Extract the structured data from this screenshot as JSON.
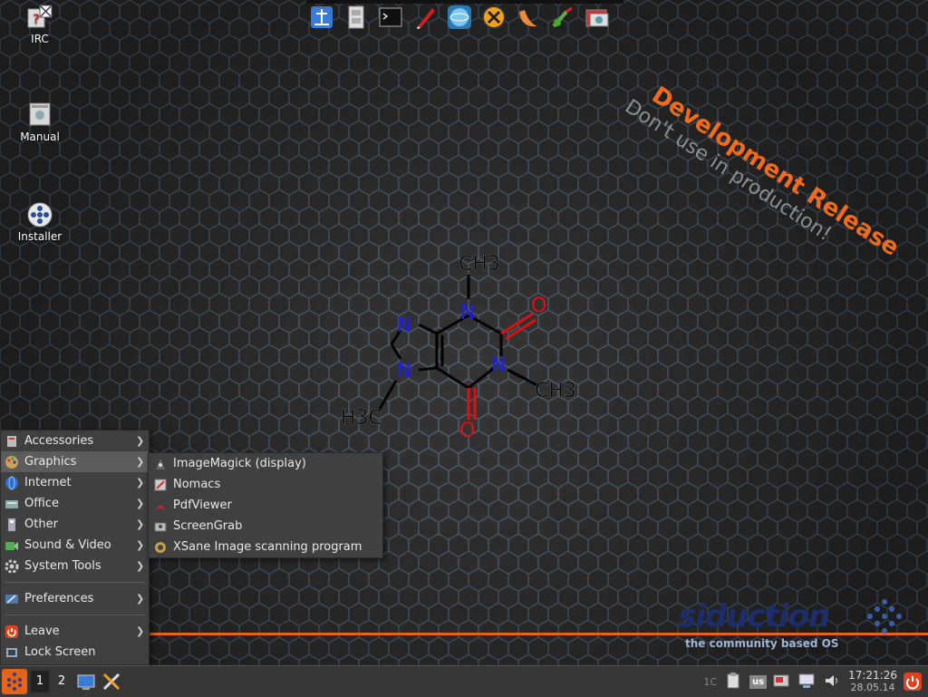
{
  "desktop": {
    "icons": [
      {
        "label": "IRC",
        "icon": "irc-help-icon"
      },
      {
        "label": "Manual",
        "icon": "manual-book-icon"
      },
      {
        "label": "Installer",
        "icon": "installer-disc-icon"
      }
    ]
  },
  "launcher": {
    "items": [
      "file-manager-icon",
      "archive-cabinet-icon",
      "terminal-icon",
      "pen-editor-icon",
      "browser-globe-icon",
      "xchat-icon",
      "pumpkin-app-icon",
      "brush-paint-icon",
      "image-viewer-icon"
    ]
  },
  "watermark": {
    "title": "Development Release",
    "subtitle": "Don't use in production!"
  },
  "molecule": {
    "labels": {
      "ch3_top": "CH3",
      "ch3_right": "CH3",
      "h3c_left": "H3C",
      "n1": "N",
      "n2": "N",
      "n3": "N",
      "n4": "N",
      "o1": "O",
      "o2": "O"
    }
  },
  "brand": {
    "name": "siduction",
    "tagline": "the community based OS"
  },
  "start_menu": {
    "items": [
      {
        "label": "Accessories",
        "submenu": true,
        "icon": "accessories-icon"
      },
      {
        "label": "Graphics",
        "submenu": true,
        "icon": "graphics-icon",
        "active": true
      },
      {
        "label": "Internet",
        "submenu": true,
        "icon": "internet-icon"
      },
      {
        "label": "Office",
        "submenu": true,
        "icon": "office-icon"
      },
      {
        "label": "Other",
        "submenu": true,
        "icon": "other-icon"
      },
      {
        "label": "Sound & Video",
        "submenu": true,
        "icon": "sound-video-icon"
      },
      {
        "label": "System Tools",
        "submenu": true,
        "icon": "system-tools-icon"
      }
    ],
    "preferences": {
      "label": "Preferences",
      "submenu": true,
      "icon": "preferences-icon"
    },
    "leave": {
      "label": "Leave",
      "submenu": true,
      "icon": "leave-icon"
    },
    "lock": {
      "label": "Lock Screen",
      "submenu": false,
      "icon": "lock-icon"
    }
  },
  "graphics_submenu": {
    "items": [
      {
        "label": "ImageMagick (display)",
        "icon": "imagemagick-icon"
      },
      {
        "label": "Nomacs",
        "icon": "nomacs-icon"
      },
      {
        "label": "PdfViewer",
        "icon": "pdf-icon"
      },
      {
        "label": "ScreenGrab",
        "icon": "screengrab-icon"
      },
      {
        "label": "XSane Image scanning program",
        "icon": "xsane-icon"
      }
    ]
  },
  "taskbar": {
    "workspaces": [
      "1",
      "2"
    ],
    "tray": {
      "temp": "1C",
      "keyboard_layout": "us",
      "time": "17:21:26",
      "date": "28.05.14"
    }
  },
  "colors": {
    "accent": "#e5641a",
    "menu_bg": "#404040",
    "menu_active": "#5c5c5c",
    "panel_bg": "#363636",
    "molecule_blue": "#1a1aff",
    "molecule_red": "#e01010"
  }
}
